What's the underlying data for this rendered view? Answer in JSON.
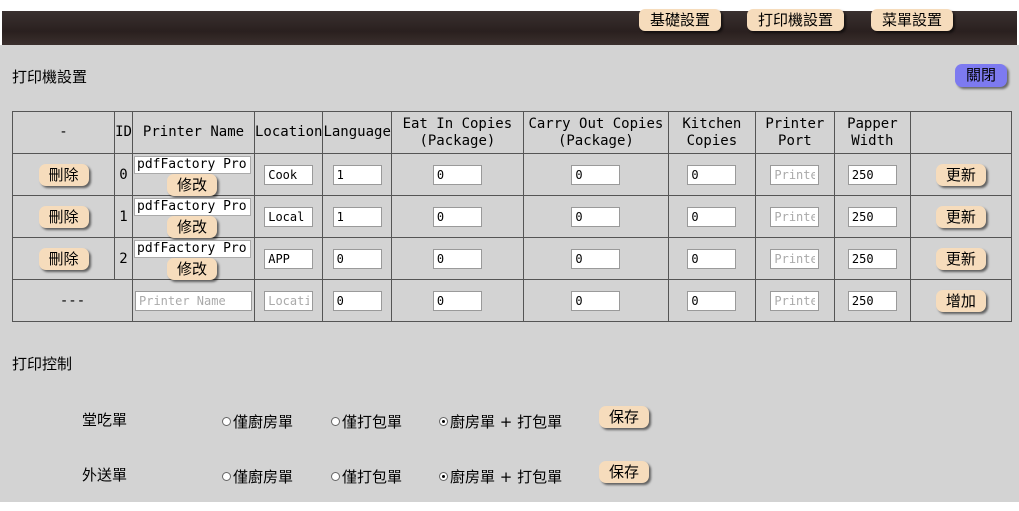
{
  "nav": {
    "basic": "基礎設置",
    "printer": "打印機設置",
    "menu": "菜單設置"
  },
  "page_title": "打印機設置",
  "close_label": "關閉",
  "table": {
    "headers": {
      "action": "-",
      "id": "ID",
      "name": "Printer Name",
      "location": "Location",
      "language": "Language",
      "eat_in_1": "Eat In Copies",
      "eat_in_2": "(Package)",
      "carry_1": "Carry Out Copies",
      "carry_2": "(Package)",
      "kitchen_1": "Kitchen",
      "kitchen_2": "Copies",
      "port_1": "Printer",
      "port_2": "Port",
      "width_1": "Papper",
      "width_2": "Width"
    },
    "rows": [
      {
        "delete": "刪除",
        "id": "0",
        "name": "pdfFactory Pro",
        "edit": "修改",
        "location": "Cook",
        "language": "1",
        "eat_in": "0",
        "carry_out": "0",
        "kitchen": "0",
        "port": "",
        "width": "250",
        "update": "更新"
      },
      {
        "delete": "刪除",
        "id": "1",
        "name": "pdfFactory Pro",
        "edit": "修改",
        "location": "Local",
        "language": "1",
        "eat_in": "0",
        "carry_out": "0",
        "kitchen": "0",
        "port": "",
        "width": "250",
        "update": "更新"
      },
      {
        "delete": "刪除",
        "id": "2",
        "name": "pdfFactory Pro",
        "edit": "修改",
        "location": "APP",
        "language": "0",
        "eat_in": "0",
        "carry_out": "0",
        "kitchen": "0",
        "port": "",
        "width": "250",
        "update": "更新"
      }
    ],
    "new_row": {
      "dash": "---",
      "name_placeholder": "Printer Name",
      "location_placeholder": "Location",
      "language": "0",
      "eat_in": "0",
      "carry_out": "0",
      "kitchen": "0",
      "width": "250",
      "add": "增加"
    },
    "port_placeholder": "Printer Port"
  },
  "print_control": {
    "title": "打印控制",
    "options": {
      "kitchen_only": "僅廚房單",
      "package_only": "僅打包單",
      "both": "廚房單 + 打包單"
    },
    "save": "保存",
    "dine_in": {
      "label": "堂吃單",
      "selected": "both"
    },
    "delivery": {
      "label": "外送單",
      "selected": "both"
    }
  }
}
